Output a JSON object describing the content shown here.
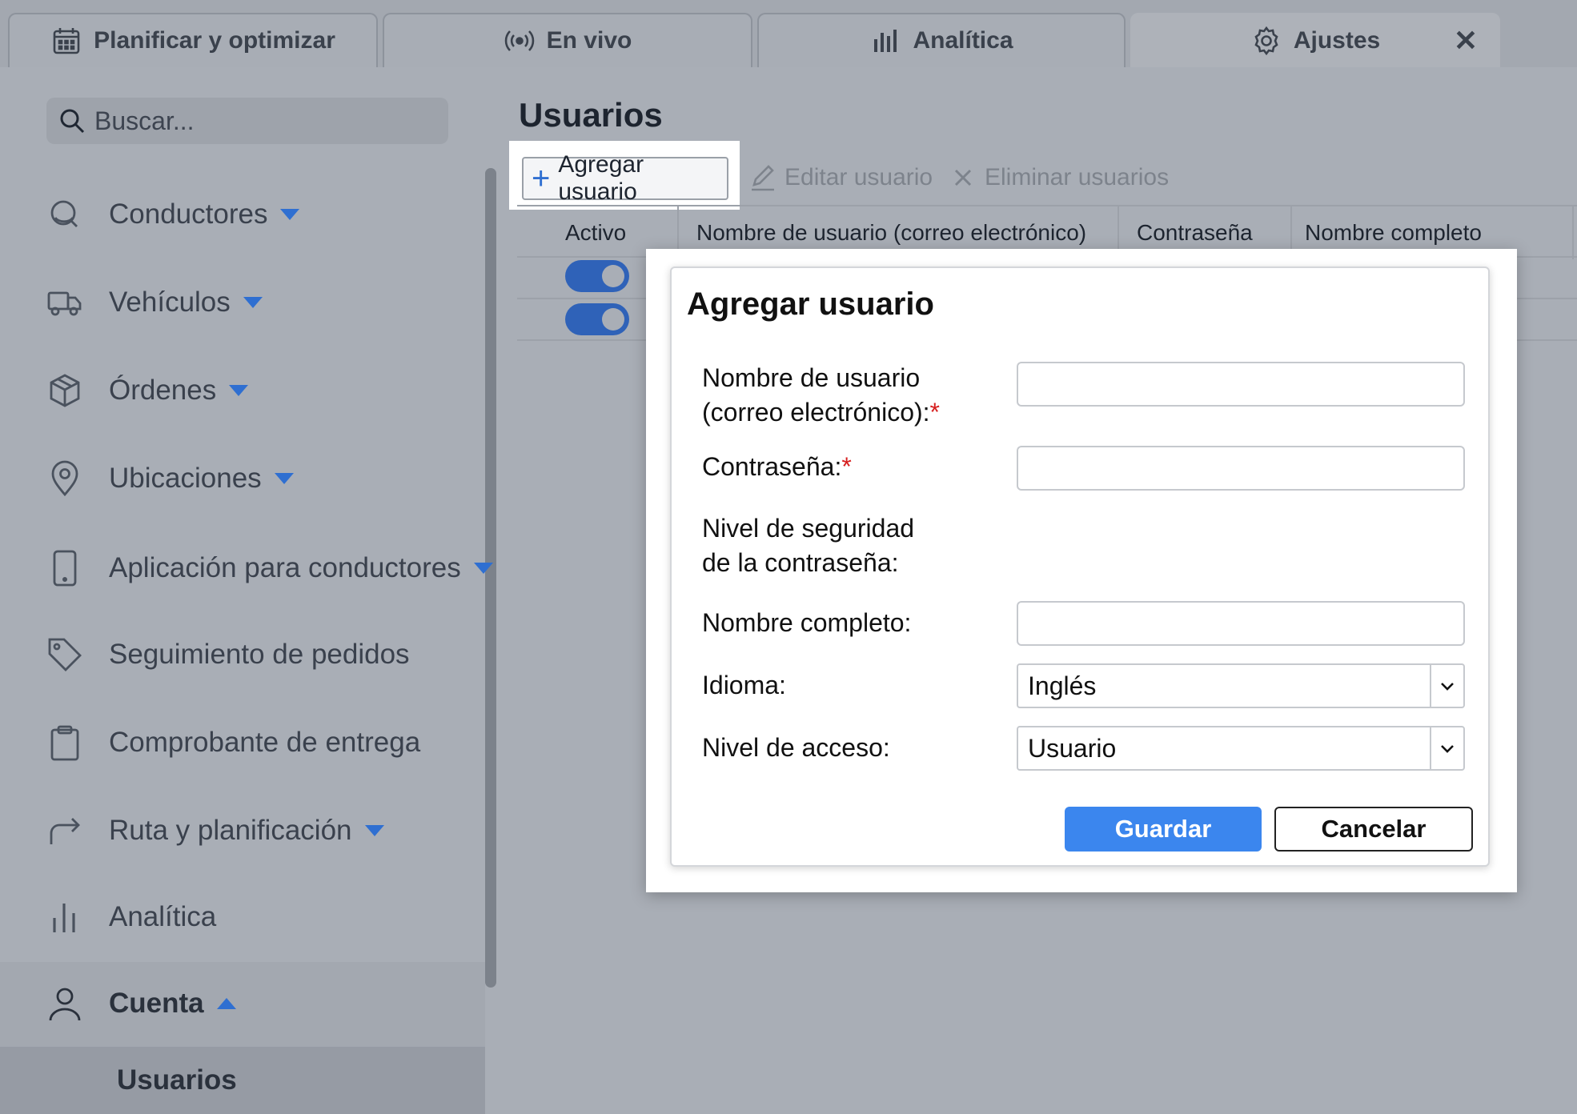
{
  "tabs": [
    {
      "label": "Planificar y optimizar",
      "icon": "calendar-icon"
    },
    {
      "label": "En vivo",
      "icon": "broadcast-icon"
    },
    {
      "label": "Analítica",
      "icon": "bar-chart-icon"
    },
    {
      "label": "Ajustes",
      "icon": "gear-icon",
      "active": true
    }
  ],
  "sidebar": {
    "search_placeholder": "Buscar...",
    "items": [
      {
        "label": "Conductores",
        "icon": "drivers-icon",
        "expandable": true
      },
      {
        "label": "Vehículos",
        "icon": "truck-icon",
        "expandable": true
      },
      {
        "label": "Órdenes",
        "icon": "package-icon",
        "expandable": true
      },
      {
        "label": "Ubicaciones",
        "icon": "location-pin-icon",
        "expandable": true
      },
      {
        "label": "Aplicación para conductores",
        "icon": "phone-icon",
        "expandable": true
      },
      {
        "label": "Seguimiento de pedidos",
        "icon": "tag-icon",
        "expandable": false
      },
      {
        "label": "Comprobante de entrega",
        "icon": "clipboard-icon",
        "expandable": false
      },
      {
        "label": "Ruta y planificación",
        "icon": "route-arrow-icon",
        "expandable": true
      },
      {
        "label": "Analítica",
        "icon": "analytics-icon",
        "expandable": false
      },
      {
        "label": "Cuenta",
        "icon": "user-icon",
        "expanded": true
      }
    ],
    "subitem": "Usuarios"
  },
  "main": {
    "title": "Usuarios",
    "toolbar": {
      "add": "Agregar usuario",
      "edit": "Editar usuario",
      "delete": "Eliminar usuarios"
    },
    "columns": [
      "Activo",
      "Nombre de usuario (correo electrónico)",
      "Contraseña",
      "Nombre completo"
    ],
    "rows": [
      {
        "active": true
      },
      {
        "active": true
      }
    ]
  },
  "modal": {
    "title": "Agregar usuario",
    "username_label_1": "Nombre de usuario",
    "username_label_2": "(correo electrónico):",
    "password_label": "Contraseña:",
    "strength_label_1": "Nivel de seguridad",
    "strength_label_2": "de la contraseña:",
    "fullname_label": "Nombre completo:",
    "language_label": "Idioma:",
    "language_value": "Inglés",
    "access_label": "Nivel de acceso:",
    "access_value": "Usuario",
    "required_mark": "*",
    "save": "Guardar",
    "cancel": "Cancelar"
  },
  "colors": {
    "accent": "#3b86ee",
    "toggle": "#2f62b8",
    "required": "#d61f1f"
  }
}
